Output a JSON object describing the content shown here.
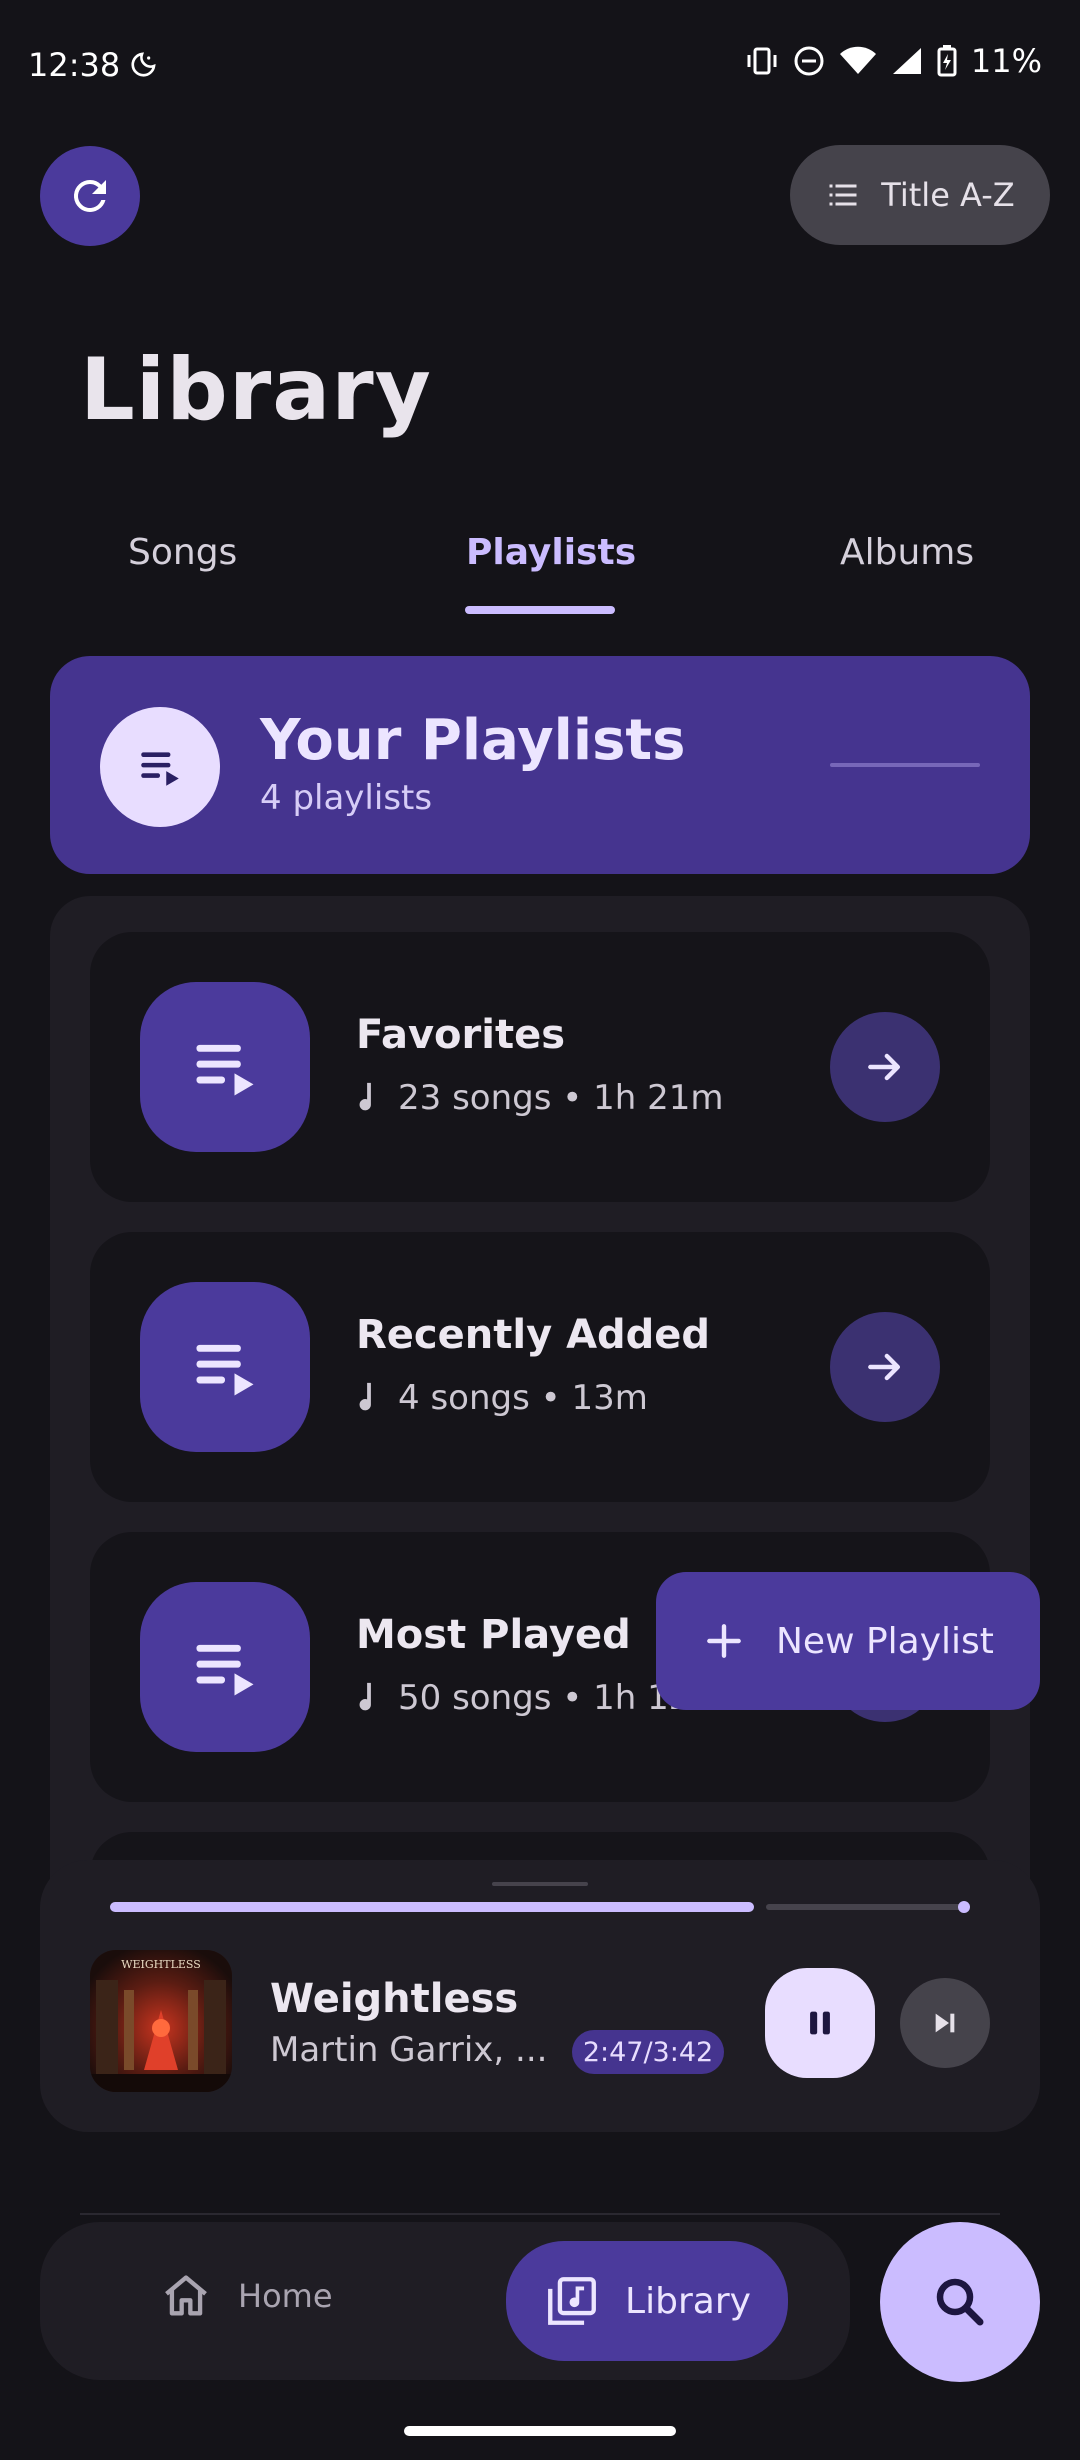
{
  "status_bar": {
    "time": "12:38",
    "battery": "11%"
  },
  "top_bar": {
    "sort_label": "Title A-Z"
  },
  "page": {
    "title": "Library"
  },
  "tabs": [
    {
      "label": "Songs",
      "selected": false
    },
    {
      "label": "Playlists",
      "selected": true
    },
    {
      "label": "Albums",
      "selected": false
    }
  ],
  "header": {
    "title": "Your Playlists",
    "subtitle": "4 playlists"
  },
  "playlists": [
    {
      "name": "Favorites",
      "meta": "23 songs • 1h 21m"
    },
    {
      "name": "Recently Added",
      "meta": "4 songs • 13m"
    },
    {
      "name": "Most Played",
      "meta": "50 songs • 1h 12m"
    }
  ],
  "fab": {
    "label": "New Playlist"
  },
  "player": {
    "title": "Weightless",
    "artist": "Martin Garrix, ...",
    "time": "2:47/3:42",
    "art_text": "WEIGHTLESS",
    "progress": 0.757
  },
  "nav": {
    "home_label": "Home",
    "library_label": "Library"
  },
  "colors": {
    "background": "#141318",
    "accent": "#4b3a9c",
    "accent_light": "#cbbcff",
    "header_card": "#45348f"
  }
}
